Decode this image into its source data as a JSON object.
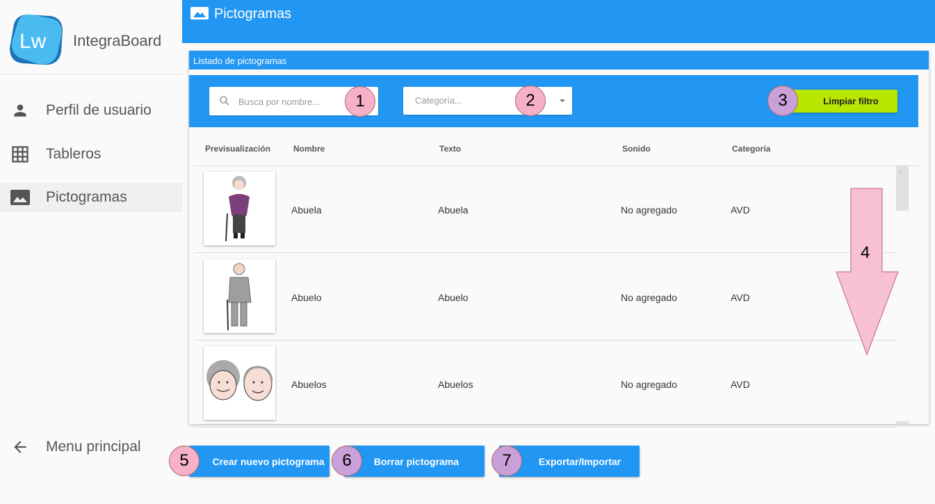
{
  "app": {
    "name": "IntegraBoard",
    "logo_text": "Lw"
  },
  "sidebar": {
    "items": [
      {
        "label": "Perfil de usuario",
        "icon": "person-icon"
      },
      {
        "label": "Tableros",
        "icon": "grid-icon"
      },
      {
        "label": "Pictogramas",
        "icon": "image-icon",
        "active": true
      }
    ],
    "back": {
      "label": "Menu principal",
      "icon": "arrow-left-icon"
    }
  },
  "header": {
    "title": "Pictogramas"
  },
  "panel": {
    "title": "Listado de pictogramas",
    "search": {
      "placeholder": "Busca por nombre..."
    },
    "category": {
      "placeholder": "Categoría..."
    },
    "clear_filter": "Limpiar filtro"
  },
  "table": {
    "columns": [
      "Previsualización",
      "Nombre",
      "Texto",
      "Sonido",
      "Categoría"
    ],
    "rows": [
      {
        "name": "Abuela",
        "text": "Abuela",
        "sound": "No agregado",
        "category": "AVD",
        "image": "grandmother-pictogram"
      },
      {
        "name": "Abuelo",
        "text": "Abuelo",
        "sound": "No agregado",
        "category": "AVD",
        "image": "grandfather-pictogram"
      },
      {
        "name": "Abuelos",
        "text": "Abuelos",
        "sound": "No agregado",
        "category": "AVD",
        "image": "grandparents-pictogram"
      }
    ]
  },
  "actions": {
    "create": "Crear nuevo pictograma",
    "delete": "Borrar pictograma",
    "export": "Exportar/Importar"
  },
  "annotations": [
    "1",
    "2",
    "3",
    "4",
    "5",
    "6",
    "7"
  ],
  "colors": {
    "primary": "#2196f3",
    "accent_lime": "#b8e600",
    "annotation_pink": "#f6b0c8",
    "annotation_purple": "#c9a0d8"
  }
}
